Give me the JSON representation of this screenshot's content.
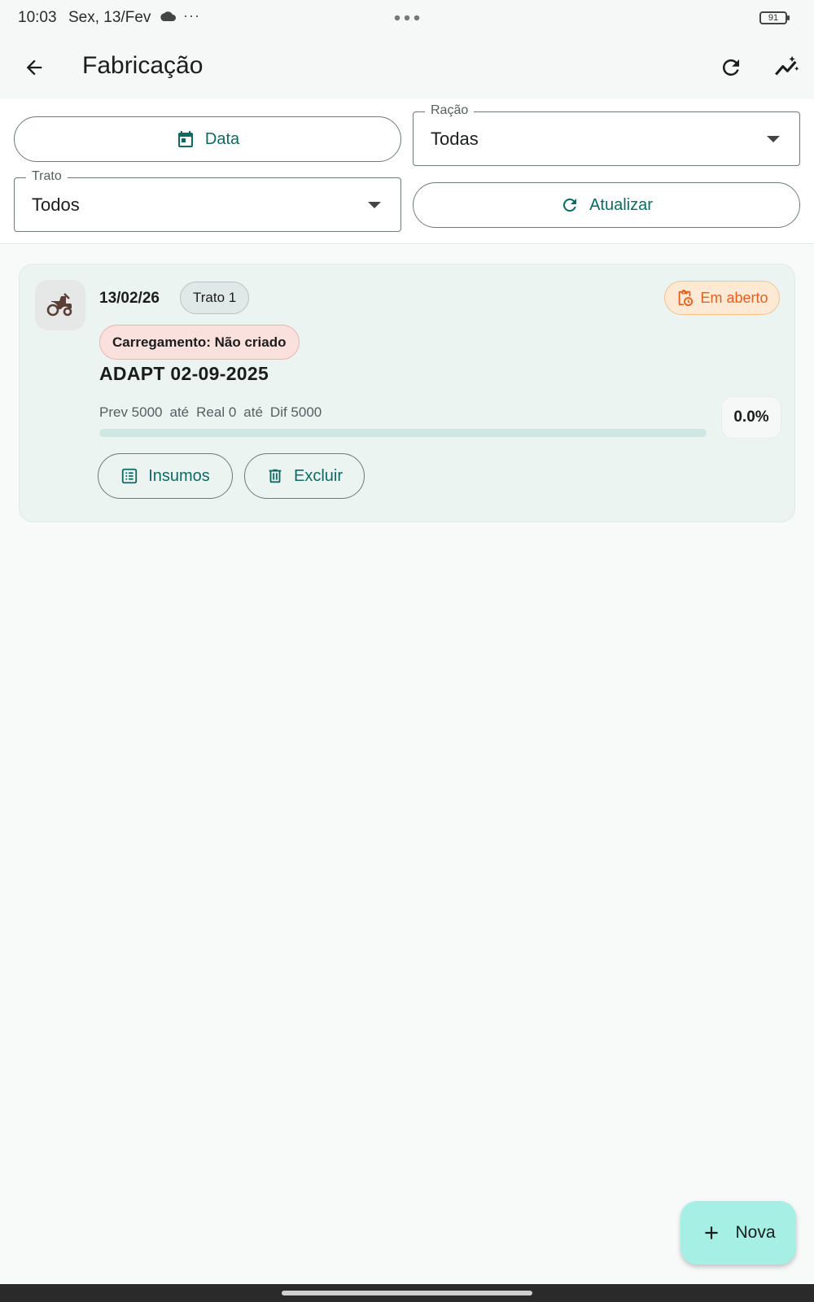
{
  "status_bar": {
    "time": "10:03",
    "date": "Sex, 13/Fev",
    "more": "···",
    "battery": "91"
  },
  "app_bar": {
    "title": "Fabricação",
    "icons": [
      "arrow-back-icon",
      "refresh-icon",
      "auto-graph-icon"
    ]
  },
  "filters": {
    "date_button": "Data",
    "racao": {
      "label": "Ração",
      "value": "Todas"
    },
    "trato": {
      "label": "Trato",
      "value": "Todos"
    },
    "update_button": "Atualizar"
  },
  "cards": [
    {
      "date": "13/02/26",
      "trato": "Trato 1",
      "status": "Em aberto",
      "carregamento": "Carregamento: Não criado",
      "name": "ADAPT 02-09-2025",
      "metrics": {
        "prev": "Prev 5000",
        "sep1": "até",
        "real": "Real 0",
        "sep2": "até",
        "dif": "Dif 5000"
      },
      "progress": 0.0,
      "percent": "0.0%",
      "actions": {
        "insumos": "Insumos",
        "excluir": "Excluir"
      }
    }
  ],
  "fab": {
    "label": "Nova"
  },
  "colors": {
    "primary": "#0b6b63",
    "status_orange": "#e2611c",
    "card_bg": "#ecf4f2",
    "fab_bg": "#a5efe4"
  }
}
